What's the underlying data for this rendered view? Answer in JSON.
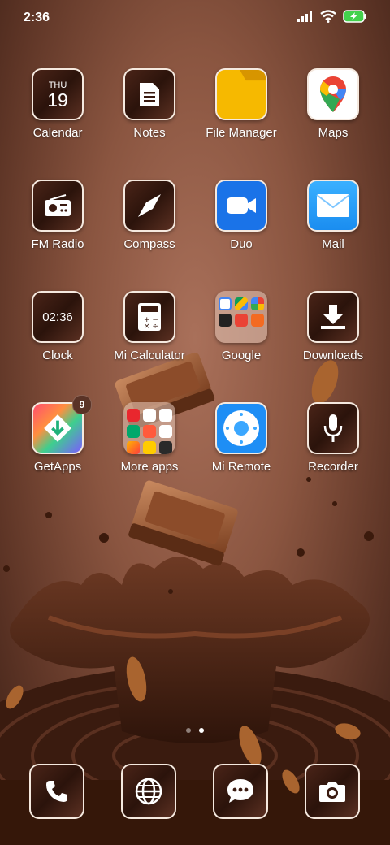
{
  "status_bar": {
    "time": "2:36"
  },
  "rows": [
    [
      {
        "label": "Calendar",
        "icon": "calendar-icon",
        "day": "THU",
        "date": "19"
      },
      {
        "label": "Notes",
        "icon": "notes-icon"
      },
      {
        "label": "File Manager",
        "icon": "folder-icon"
      },
      {
        "label": "Maps",
        "icon": "maps-pin-icon"
      }
    ],
    [
      {
        "label": "FM Radio",
        "icon": "radio-icon"
      },
      {
        "label": "Compass",
        "icon": "compass-icon"
      },
      {
        "label": "Duo",
        "icon": "video-camera-icon"
      },
      {
        "label": "Mail",
        "icon": "mail-icon"
      }
    ],
    [
      {
        "label": "Clock",
        "icon": "clock-icon",
        "time": "02:36"
      },
      {
        "label": "Mi Calculator",
        "icon": "calculator-icon"
      },
      {
        "label": "Google",
        "icon": "google-folder-icon"
      },
      {
        "label": "Downloads",
        "icon": "download-icon"
      }
    ],
    [
      {
        "label": "GetApps",
        "icon": "getapps-icon",
        "badge": "9"
      },
      {
        "label": "More apps",
        "icon": "more-apps-folder-icon"
      },
      {
        "label": "Mi Remote",
        "icon": "remote-icon"
      },
      {
        "label": "Recorder",
        "icon": "microphone-icon"
      }
    ]
  ],
  "dock": [
    {
      "icon": "phone-icon"
    },
    {
      "icon": "browser-globe-icon"
    },
    {
      "icon": "messages-icon"
    },
    {
      "icon": "camera-icon"
    }
  ],
  "page_indicator": {
    "pages": 2,
    "current": 2
  }
}
